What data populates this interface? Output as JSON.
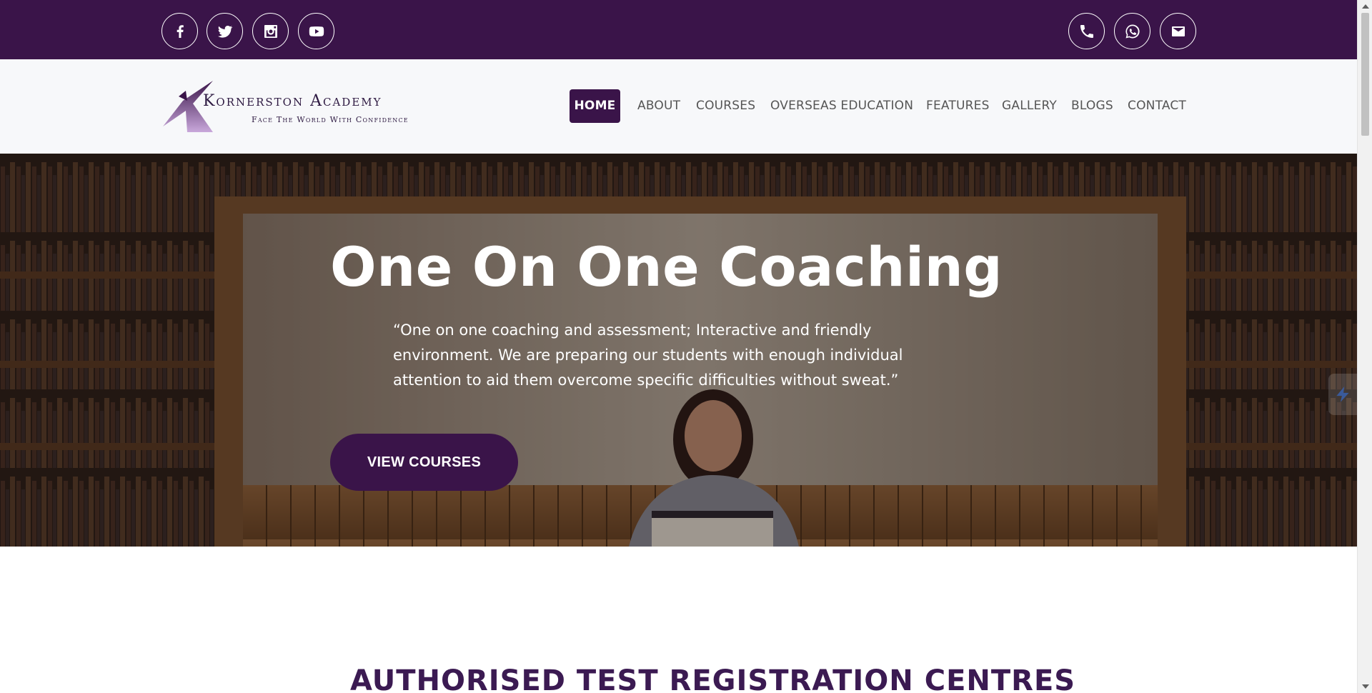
{
  "colors": {
    "brand": "#3a1449",
    "brand_dark": "#2e1a42",
    "nav_text": "#555555",
    "heading": "#3b1a52"
  },
  "social": [
    {
      "icon": "facebook-icon"
    },
    {
      "icon": "twitter-icon"
    },
    {
      "icon": "instagram-icon"
    },
    {
      "icon": "youtube-icon"
    }
  ],
  "contact_icons": [
    {
      "icon": "phone-icon"
    },
    {
      "icon": "whatsapp-icon"
    },
    {
      "icon": "mail-icon"
    }
  ],
  "logo": {
    "name": "Kornerston Academy",
    "tagline": "Face The World With Confidence"
  },
  "nav": {
    "home": "HOME",
    "about": "ABOUT",
    "courses": "COURSES",
    "overseas": "OVERSEAS EDUCATION",
    "features": "FEATURES",
    "gallery": "GALLERY",
    "blogs": "BLOGS",
    "contact": "CONTACT"
  },
  "hero": {
    "title": "One On One Coaching",
    "quote": "“One on one coaching and assessment; Interactive and friendly environment. We are preparing our students with enough individual attention to aid them overcome specific difficulties without sweat.”",
    "cta": "VIEW COURSES"
  },
  "section": {
    "title": "AUTHORISED TEST REGISTRATION CENTRES"
  }
}
